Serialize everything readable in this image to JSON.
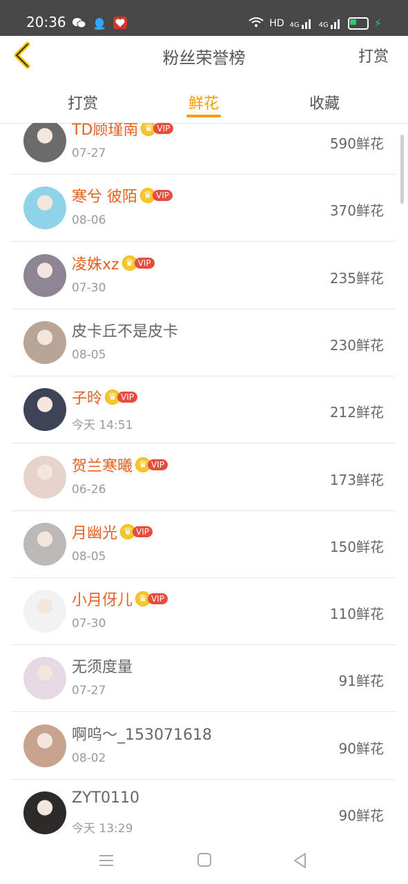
{
  "status_bar": {
    "time": "20:36",
    "left_icons": [
      "wechat-icon",
      "qq-icon",
      "app-heart-icon"
    ],
    "right_icons": [
      "wifi-icon",
      "hd-icon",
      "signal-4g-icon",
      "signal-4g-icon",
      "battery-icon",
      "charging-icon"
    ],
    "hd_text": "HD",
    "signal1_text": "4G",
    "signal2_text": "4G",
    "battery_level": 0.4
  },
  "header": {
    "title": "粉丝荣誉榜",
    "action_label": "打赏"
  },
  "tabs": [
    {
      "label": "打赏",
      "active": false
    },
    {
      "label": "鲜花",
      "active": true
    },
    {
      "label": "收藏",
      "active": false
    }
  ],
  "vip_label": "VIP",
  "list": [
    {
      "name": "TD顾瑾南",
      "vip": true,
      "date": "07-27",
      "amount": "590鲜花",
      "avatar_color": "#6b6b6b"
    },
    {
      "name": "寒兮 彼陌",
      "vip": true,
      "date": "08-06",
      "amount": "370鲜花",
      "avatar_color": "#8fd3e8"
    },
    {
      "name": "凌姝xz",
      "vip": true,
      "date": "07-30",
      "amount": "235鲜花",
      "avatar_color": "#8d8593"
    },
    {
      "name": "皮卡丘不是皮卡",
      "vip": false,
      "date": "08-05",
      "amount": "230鲜花",
      "avatar_color": "#b9a596"
    },
    {
      "name": "子昤",
      "vip": true,
      "date": "今天 14:51",
      "amount": "212鲜花",
      "avatar_color": "#3f4357"
    },
    {
      "name": "贺兰寒曦",
      "vip": true,
      "date": "06-26",
      "amount": "173鲜花",
      "avatar_color": "#e6d3c9"
    },
    {
      "name": "月幽光",
      "vip": true,
      "date": "08-05",
      "amount": "150鲜花",
      "avatar_color": "#bdb9b9"
    },
    {
      "name": "小月伢儿",
      "vip": true,
      "date": "07-30",
      "amount": "110鲜花",
      "avatar_color": "#f2f2f2"
    },
    {
      "name": "无须度量",
      "vip": false,
      "date": "07-27",
      "amount": "91鲜花",
      "avatar_color": "#e7d9e4"
    },
    {
      "name": "啊呜～_153071618",
      "vip": false,
      "date": "08-02",
      "amount": "90鲜花",
      "avatar_color": "#c7a48e"
    },
    {
      "name": "ZYT0110",
      "vip": false,
      "date": "今天 13:29",
      "amount": "90鲜花",
      "avatar_color": "#2d2a2a"
    }
  ],
  "nav": [
    "menu-icon",
    "home-icon",
    "back-triangle-icon"
  ]
}
